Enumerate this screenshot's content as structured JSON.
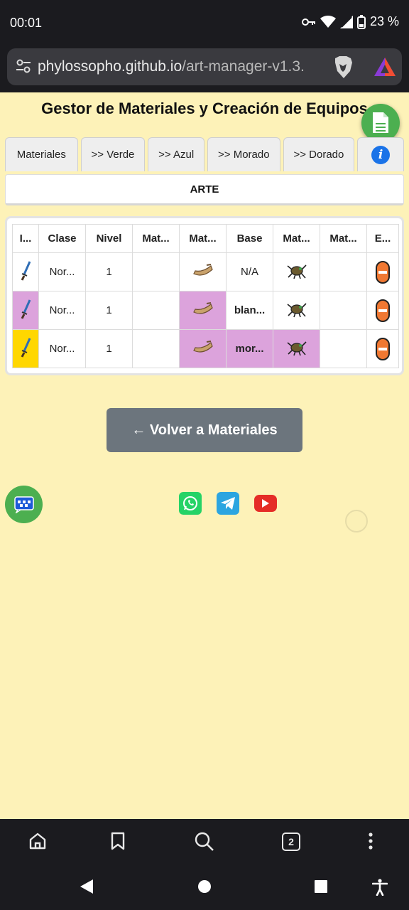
{
  "status_bar": {
    "time": "00:01",
    "battery": "23 %"
  },
  "browser": {
    "url_main": "phylossopho.github.io",
    "url_path": "/art-manager-v1.3.",
    "tab_count": "2"
  },
  "page": {
    "title": "Gestor de Materiales y Creación de Equipos",
    "tabs": [
      {
        "label": "Materiales"
      },
      {
        "label": ">> Verde"
      },
      {
        "label": ">> Azul"
      },
      {
        "label": ">> Morado"
      },
      {
        "label": ">> Dorado"
      },
      {
        "label": "i"
      }
    ],
    "section_label": "ARTE",
    "table": {
      "headers": [
        "I...",
        "Clase",
        "Nivel",
        "Mat...",
        "Mat...",
        "Base",
        "Mat...",
        "Mat...",
        "E..."
      ],
      "rows": [
        {
          "clase": "Nor...",
          "nivel": "1",
          "base": "N/A"
        },
        {
          "clase": "Nor...",
          "nivel": "1",
          "base": "blan..."
        },
        {
          "clase": "Nor...",
          "nivel": "1",
          "base": "mor..."
        }
      ]
    },
    "back_button": "← Volver a Materiales"
  },
  "colors": {
    "page_bg": "#fdf2b8",
    "purple_cell": "#dca3dc",
    "gold_cell": "#ffd700",
    "fab_green": "#4caf50",
    "back_button": "#6c757d"
  }
}
